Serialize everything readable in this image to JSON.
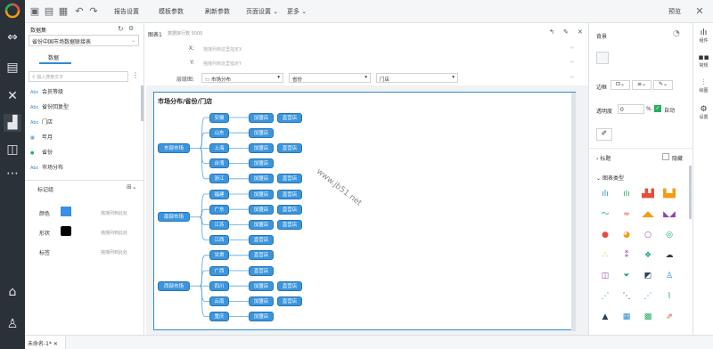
{
  "toolbar": {
    "report_settings": "报告设置",
    "template_params": "模板参数",
    "refresh_params": "刷新参数",
    "page_settings": "页面设置",
    "more": "更多",
    "preview": "预览"
  },
  "dataset": {
    "title": "数据集",
    "selected": "省份中国市场数据联接表",
    "tab_data": "数据",
    "search_placeholder": "输入搜索文字",
    "fields": [
      {
        "type": "Abc",
        "label": "会员等级"
      },
      {
        "type": "Abc",
        "label": "省份回复型"
      },
      {
        "type": "Abc",
        "label": "门店"
      },
      {
        "type": "cal",
        "label": "年月"
      },
      {
        "type": "geo",
        "label": "省份"
      },
      {
        "type": "Abc",
        "label": "市场分布"
      }
    ]
  },
  "marks": {
    "title": "标记组",
    "rows": [
      {
        "label": "颜色",
        "hint": "拖拽列到此处"
      },
      {
        "label": "形状",
        "hint": "拖拽列到此处"
      },
      {
        "label": "标签",
        "hint": "拖拽列到此处"
      }
    ]
  },
  "chart_header": {
    "title": "图表1",
    "subtitle": "数据库行数 5000",
    "x_label": "X:",
    "x_placeholder": "拖拽列到这里指定X",
    "y_label": "Y:",
    "y_placeholder": "拖拽列到这里指定Y",
    "hier_label": "层级图:",
    "hier_fields": [
      "市场分布",
      "省份",
      "门店"
    ]
  },
  "chart_data": {
    "type": "tree",
    "title": "市场分布/省份/门店",
    "root_children": [
      {
        "name": "东部市场",
        "provinces": [
          {
            "name": "安徽",
            "stores": [
              "加盟店",
              "直营店"
            ]
          },
          {
            "name": "山东",
            "stores": [
              "加盟店"
            ]
          },
          {
            "name": "上海",
            "stores": [
              "加盟店",
              "直营店"
            ]
          },
          {
            "name": "台湾",
            "stores": [
              "加盟店"
            ]
          },
          {
            "name": "浙江",
            "stores": [
              "加盟店",
              "直营店"
            ]
          }
        ]
      },
      {
        "name": "南部市场",
        "provinces": [
          {
            "name": "福建",
            "stores": [
              "加盟店",
              "直营店"
            ]
          },
          {
            "name": "广东",
            "stores": [
              "加盟店",
              "直营店"
            ]
          },
          {
            "name": "江苏",
            "stores": [
              "加盟店",
              "直营店"
            ]
          },
          {
            "name": "江西",
            "stores": [
              "直营店"
            ]
          }
        ]
      },
      {
        "name": "西部市场",
        "provinces": [
          {
            "name": "甘肃",
            "stores": [
              "直营店"
            ]
          },
          {
            "name": "广西",
            "stores": [
              "直营店"
            ]
          },
          {
            "name": "四川",
            "stores": [
              "加盟店",
              "直营店"
            ]
          },
          {
            "name": "云南",
            "stores": [
              "加盟店",
              "直营店"
            ]
          },
          {
            "name": "重庆",
            "stores": [
              "加盟店"
            ]
          }
        ]
      }
    ]
  },
  "watermark": "www.jb51.net",
  "right_panel": {
    "title": "背景",
    "border_label": "边框",
    "opacity_label": "透明度",
    "opacity_value": "0",
    "opacity_unit": "%",
    "auto_label": "自动",
    "title_section": "标题",
    "hide_label": "隐藏",
    "chart_type_section": "图表类型"
  },
  "rail": [
    "组件",
    "常规",
    "绘图",
    "设置"
  ],
  "bottom": {
    "tab": "未命名-1*"
  },
  "colors": {
    "nav_bg": "#2a3138",
    "accent": "#3a95dd",
    "mark_color": "#3a8fe8"
  }
}
